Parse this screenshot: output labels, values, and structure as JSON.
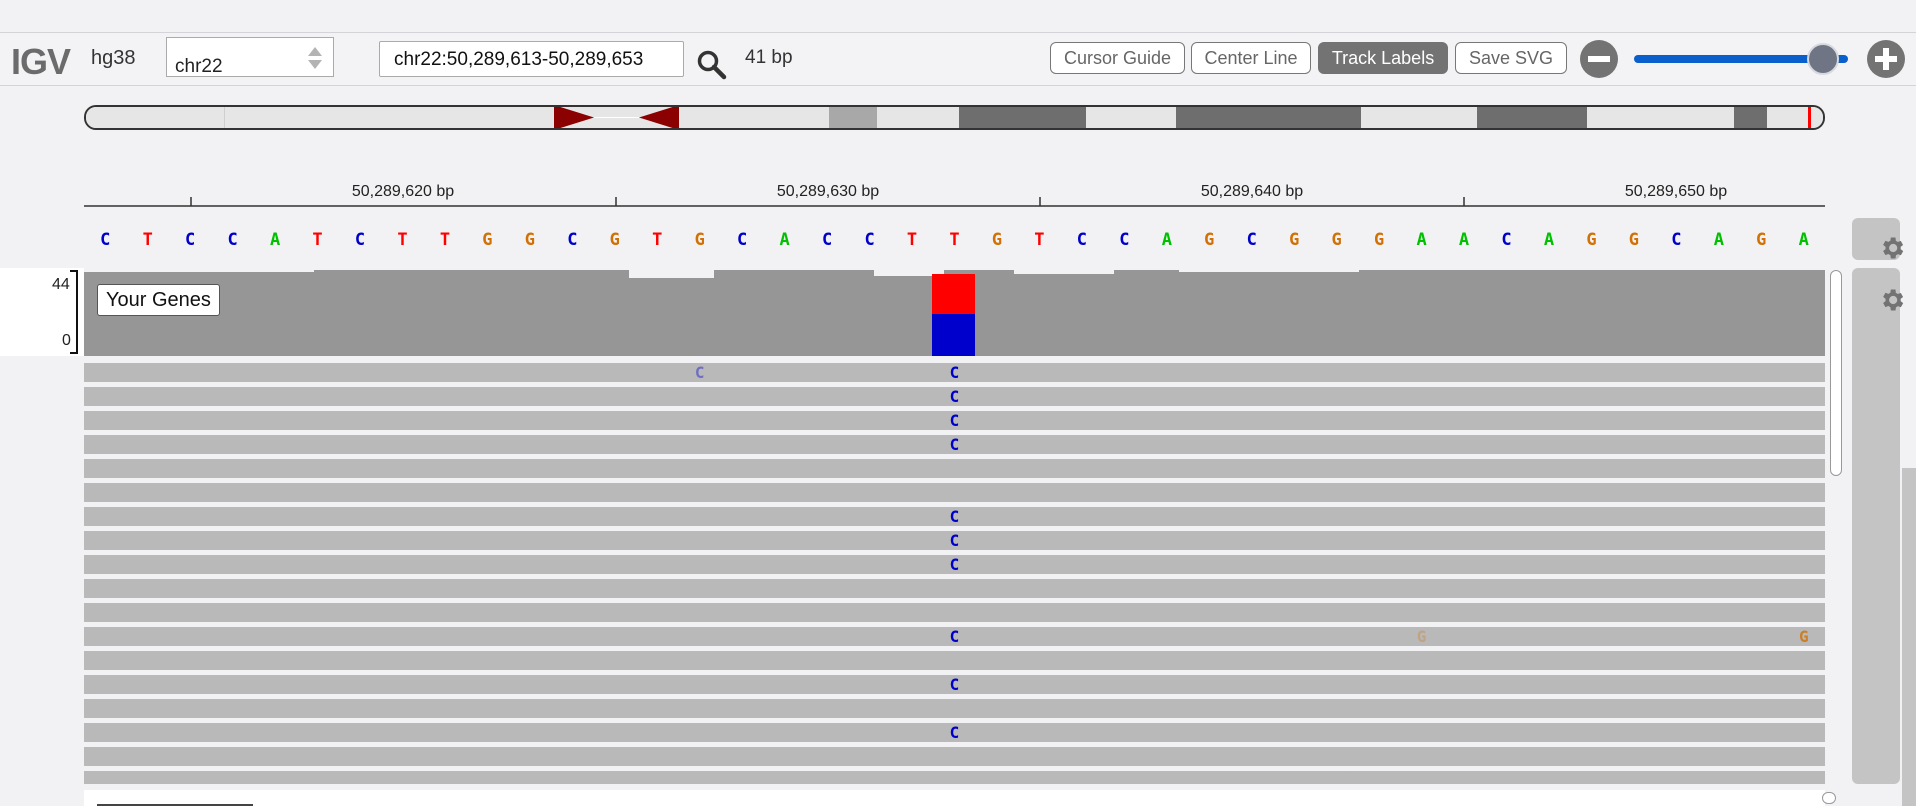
{
  "toolbar": {
    "logo": "IGV",
    "genome": "hg38",
    "chromosome": "chr22",
    "locus": "chr22:50,289,613-50,289,653",
    "bp_width": "41 bp",
    "buttons": {
      "cursor_guide": "Cursor Guide",
      "center_line": "Center Line",
      "track_labels": "Track Labels",
      "save_svg": "Save SVG"
    },
    "zoom_level": 0.93
  },
  "ruler": {
    "ticks": [
      "50,289,620 bp",
      "50,289,630 bp",
      "50,289,640 bp",
      "50,289,650 bp"
    ]
  },
  "sequence": {
    "bases": [
      "C",
      "T",
      "C",
      "C",
      "A",
      "T",
      "C",
      "T",
      "T",
      "G",
      "G",
      "C",
      "G",
      "T",
      "G",
      "C",
      "A",
      "C",
      "C",
      "T",
      "T",
      "G",
      "T",
      "C",
      "C",
      "A",
      "G",
      "C",
      "G",
      "G",
      "G",
      "A",
      "A",
      "C",
      "A",
      "G",
      "G",
      "C",
      "A",
      "G",
      "A"
    ]
  },
  "coverage": {
    "max": "44",
    "min": "0"
  },
  "track": {
    "label": "Your Genes"
  },
  "alignments": {
    "mismatch_base": "C",
    "other_base": "G"
  },
  "colors": {
    "A": "#00c000",
    "C": "#0000cc",
    "G": "#d17105",
    "T": "#ff0000",
    "accent": "#0a5fcc",
    "coverage": "#969696",
    "read": "#b9b9b9"
  },
  "icons": {
    "search": "search-icon",
    "zoom_out": "minus-circle-icon",
    "zoom_in": "plus-circle-icon",
    "gear": "gear-icon"
  }
}
